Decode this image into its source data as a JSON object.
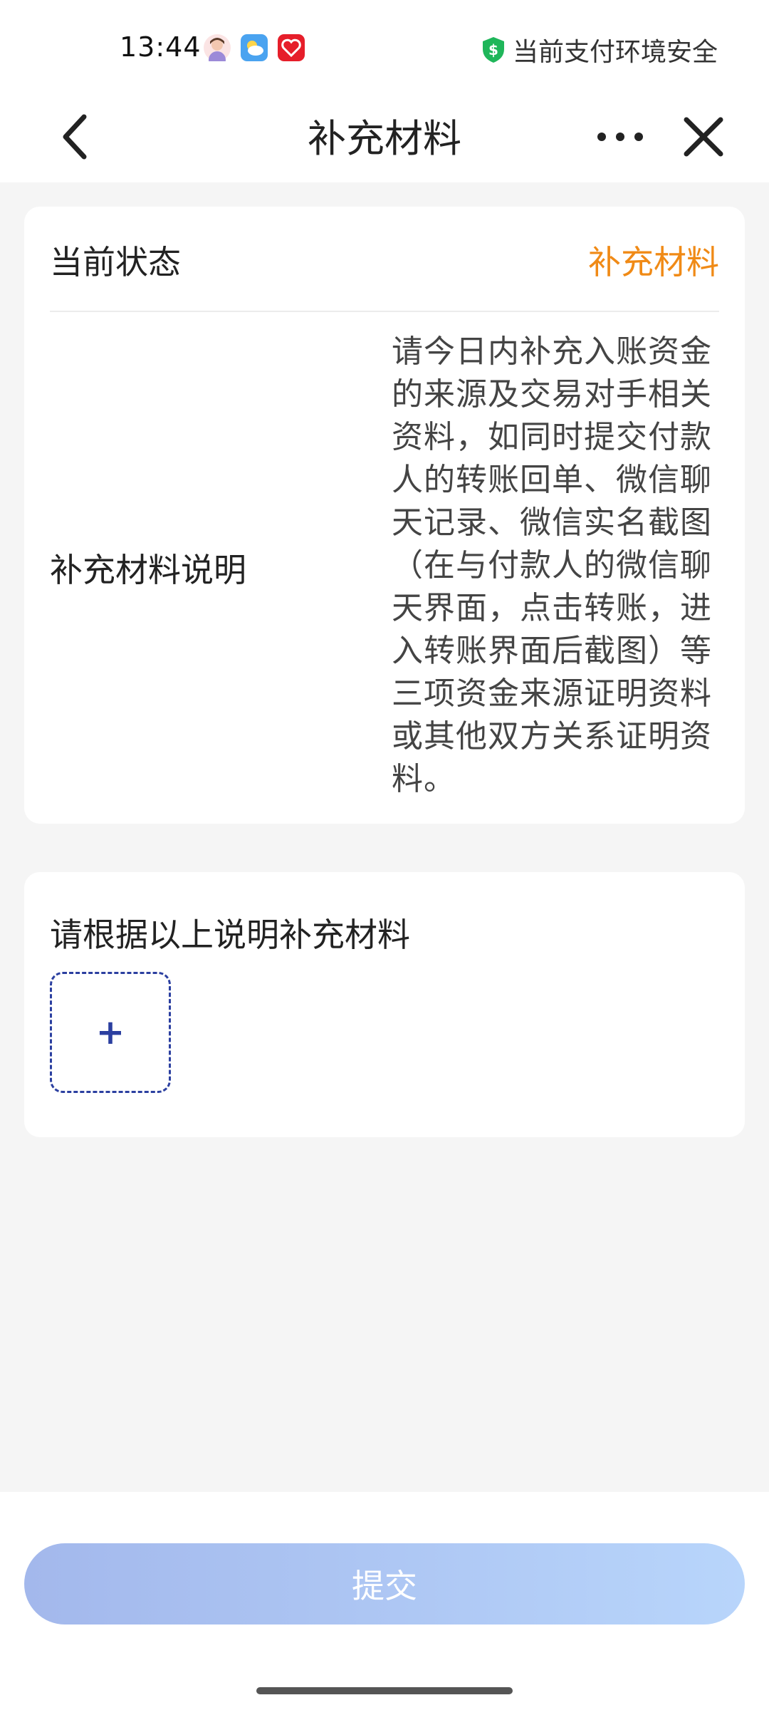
{
  "status_bar": {
    "time": "13:44",
    "secure_text": "当前支付环境安全",
    "icons": [
      "avatar-icon",
      "weather-icon",
      "heart-app-icon",
      "shield-dollar-icon"
    ]
  },
  "nav": {
    "title": "补充材料",
    "icons": [
      "back-icon",
      "more-icon",
      "close-icon"
    ]
  },
  "status_card": {
    "status_label": "当前状态",
    "status_value": "补充材料",
    "status_value_color": "#f08a16",
    "description_label": "补充材料说明",
    "description_text": "请今日内补充入账资金的来源及交易对手相关资料，如同时提交付款人的转账回单、微信聊天记录、微信实名截图（在与付款人的微信聊天界面，点击转账，进入转账界面后截图）等三项资金来源证明资料或其他双方关系证明资料。"
  },
  "upload_card": {
    "label": "请根据以上说明补充材料",
    "plus": "+"
  },
  "submit": {
    "label": "提交",
    "gradient_start": "#a3b8ec",
    "gradient_end": "#b8d5fb"
  }
}
